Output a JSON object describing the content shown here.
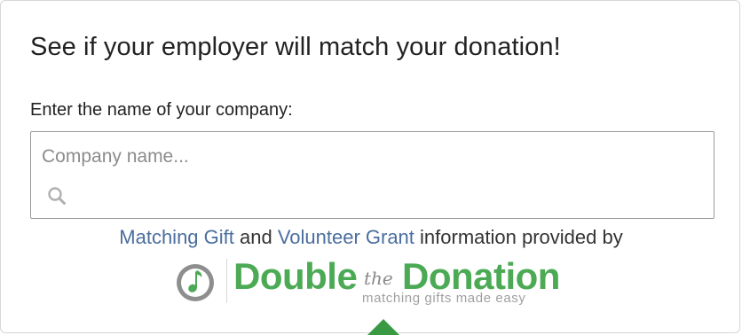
{
  "widget": {
    "title": "See if your employer will match your donation!",
    "field_label": "Enter the name of your company:",
    "search": {
      "placeholder": "Company name...",
      "value": "",
      "icon": "search-icon"
    },
    "attribution": {
      "link_matching_gift": "Matching Gift",
      "and_text": " and ",
      "link_volunteer_grant": "Volunteer Grant",
      "suffix_text": " information provided by"
    },
    "logo": {
      "word_double": "Double",
      "word_the": "the",
      "word_donation": "Donation",
      "tagline": "matching gifts made easy",
      "mark_icon": "double-the-donation-mark-icon"
    }
  },
  "colors": {
    "link": "#4a6e9e",
    "brand_green": "#4caa55",
    "text": "#222222",
    "border": "#9a9a9a"
  },
  "overlay": {
    "icon": "green-arrow-cursor-icon"
  }
}
